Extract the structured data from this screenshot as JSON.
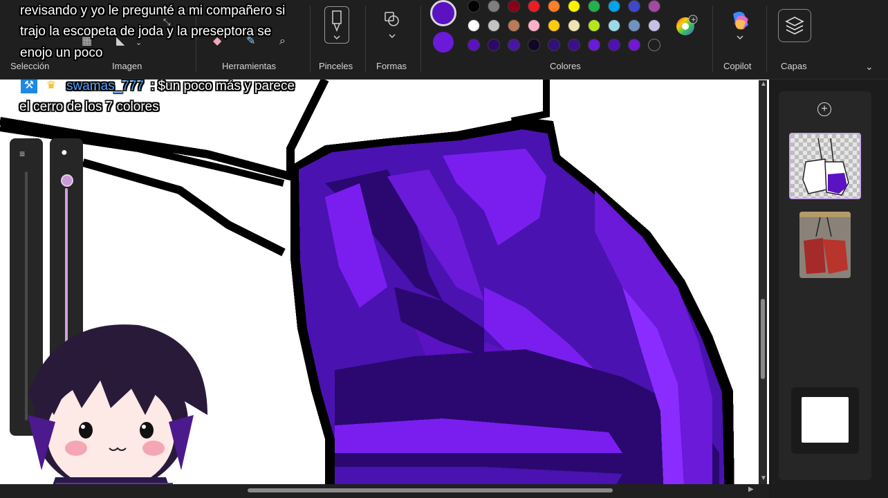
{
  "toolbar": {
    "groups": {
      "selection": "Selección",
      "image": "Imagen",
      "tools": "Herramientas",
      "brushes": "Pinceles",
      "shapes": "Formas",
      "colors": "Colores",
      "copilot": "Copilot",
      "layers": "Capas"
    },
    "primary_color": "#5b12c2",
    "secondary_color": "#6a1ad8",
    "palette_row1": [
      "#000000",
      "#7f7f7f",
      "#880015",
      "#ed1c24",
      "#ff7f27",
      "#fff200",
      "#22b14c",
      "#00a2e8",
      "#3f48cc",
      "#a349a4"
    ],
    "palette_row2": [
      "#ffffff",
      "#c3c3c3",
      "#b97a57",
      "#ffaec9",
      "#ffc90e",
      "#efe4b0",
      "#b5e61d",
      "#99d9ea",
      "#7092be",
      "#c8bfe7"
    ],
    "palette_row3": [
      "#5b12c2",
      "#2a0a66",
      "#4b14a6",
      "#120626",
      "#32107a",
      "#3c0f8c",
      "#6a1ad8",
      "#5010b4",
      "#7416d6",
      ""
    ]
  },
  "stream": {
    "message_top_lines": [
      "revisando y yo le pregunté a mi compañero si",
      "trajo la escopeta de joda y la preseptora se",
      "enojo un poco"
    ],
    "chat_user": "swamas_777",
    "chat_message_line1": ": $un poco más y parece",
    "chat_message_line2": "el cerro de los 7 colores"
  },
  "layers": {
    "add_icon": "plus-circle-icon",
    "items": [
      {
        "name": "layer-gloves-lineart",
        "selected": true
      },
      {
        "name": "layer-gloves-reference",
        "selected": false
      }
    ],
    "background_color": "#ffffff"
  },
  "colors": {
    "purple_dark": "#1a0640",
    "purple_mid": "#4a12b0",
    "purple_light": "#7a1ef0",
    "outline": "#000000"
  }
}
